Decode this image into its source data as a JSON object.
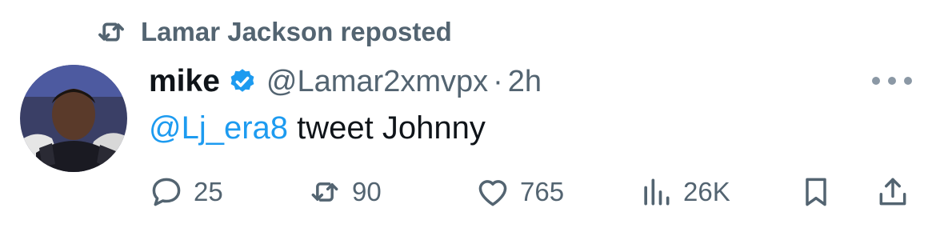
{
  "repost": {
    "text": "Lamar Jackson reposted",
    "icon": "repost-icon"
  },
  "author": {
    "name": "mike",
    "verified": true,
    "badge_color": "#1d9bf0",
    "handle": "@Lamar2xmvpx",
    "separator": "·",
    "time": "2h",
    "avatar": "profile-photo"
  },
  "tweet": {
    "mention": "@Lj_era8",
    "text": " tweet Johnny",
    "mention_color": "#1d9bf0"
  },
  "actions": {
    "replies": "25",
    "reposts": "90",
    "likes": "765",
    "views": "26K"
  },
  "colors": {
    "secondary_text": "#536471",
    "primary_text": "#0f1419"
  }
}
